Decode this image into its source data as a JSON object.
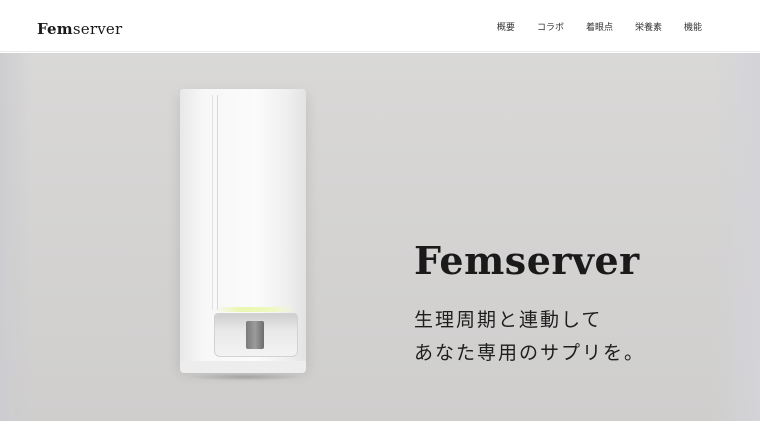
{
  "header": {
    "logo_prefix": "Fem",
    "logo_suffix": "server",
    "nav": [
      {
        "label": "概要"
      },
      {
        "label": "コラボ"
      },
      {
        "label": "着眼点"
      },
      {
        "label": "栄養素"
      },
      {
        "label": "機能"
      }
    ]
  },
  "hero": {
    "title_prefix": "Fem",
    "title_suffix": "server",
    "tagline_line1": "生理周期と連動して",
    "tagline_line2": "あなた専用のサプリを。"
  }
}
